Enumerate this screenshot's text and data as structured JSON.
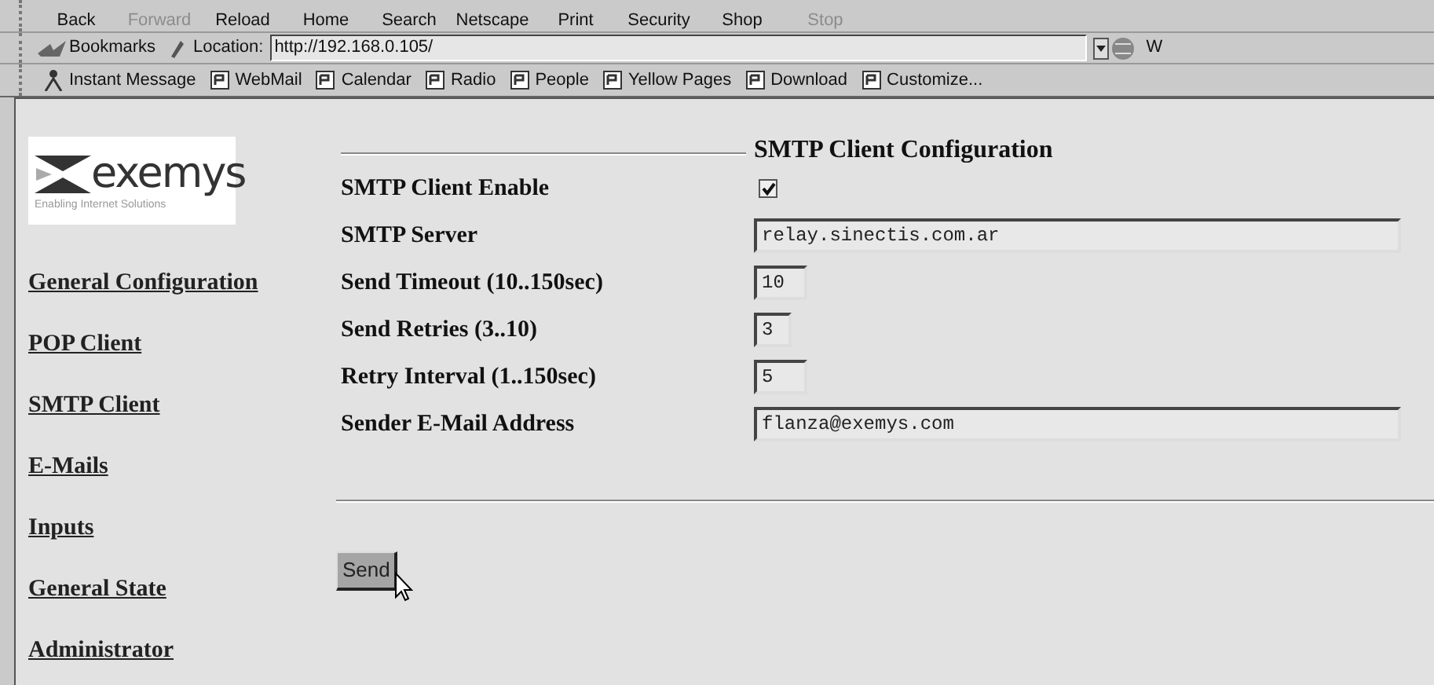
{
  "toolbar": {
    "buttons": [
      {
        "label": "Back",
        "disabled": false
      },
      {
        "label": "Forward",
        "disabled": true
      },
      {
        "label": "Reload",
        "disabled": false
      },
      {
        "label": "Home",
        "disabled": false
      },
      {
        "label": "Search",
        "disabled": false
      },
      {
        "label": "Netscape",
        "disabled": false
      },
      {
        "label": "Print",
        "disabled": false
      },
      {
        "label": "Security",
        "disabled": false
      },
      {
        "label": "Shop",
        "disabled": false
      },
      {
        "label": "Stop",
        "disabled": true
      }
    ]
  },
  "location_bar": {
    "bookmarks_label": "Bookmarks",
    "location_label": "Location:",
    "url": "http://192.168.0.105/",
    "related_label": "W"
  },
  "personal_toolbar": [
    {
      "label": "Instant Message",
      "kind": "person"
    },
    {
      "label": "WebMail",
      "kind": "bookmark"
    },
    {
      "label": "Calendar",
      "kind": "bookmark"
    },
    {
      "label": "Radio",
      "kind": "bookmark"
    },
    {
      "label": "People",
      "kind": "bookmark"
    },
    {
      "label": "Yellow Pages",
      "kind": "bookmark"
    },
    {
      "label": "Download",
      "kind": "bookmark"
    },
    {
      "label": "Customize...",
      "kind": "bookmark"
    }
  ],
  "sidebar": {
    "logo": {
      "wordmark": "exemys",
      "tagline": "Enabling Internet Solutions"
    },
    "links": [
      "General Configuration",
      "POP Client",
      "SMTP Client",
      "E-Mails",
      "Inputs",
      "General State",
      "Administrator"
    ]
  },
  "form": {
    "title": "SMTP Client Configuration",
    "fields": [
      {
        "label": "SMTP Client Enable",
        "kind": "checkbox",
        "checked": true
      },
      {
        "label": "SMTP Server",
        "kind": "wide",
        "value": "relay.sinectis.com.ar"
      },
      {
        "label": "Send Timeout (10..150sec)",
        "kind": "short",
        "value": "10"
      },
      {
        "label": "Send Retries (3..10)",
        "kind": "narrow",
        "value": "3"
      },
      {
        "label": "Retry Interval (1..150sec)",
        "kind": "short",
        "value": "5"
      },
      {
        "label": "Sender E-Mail Address",
        "kind": "wide",
        "value": "flanza@exemys.com"
      }
    ],
    "submit": "Send"
  }
}
